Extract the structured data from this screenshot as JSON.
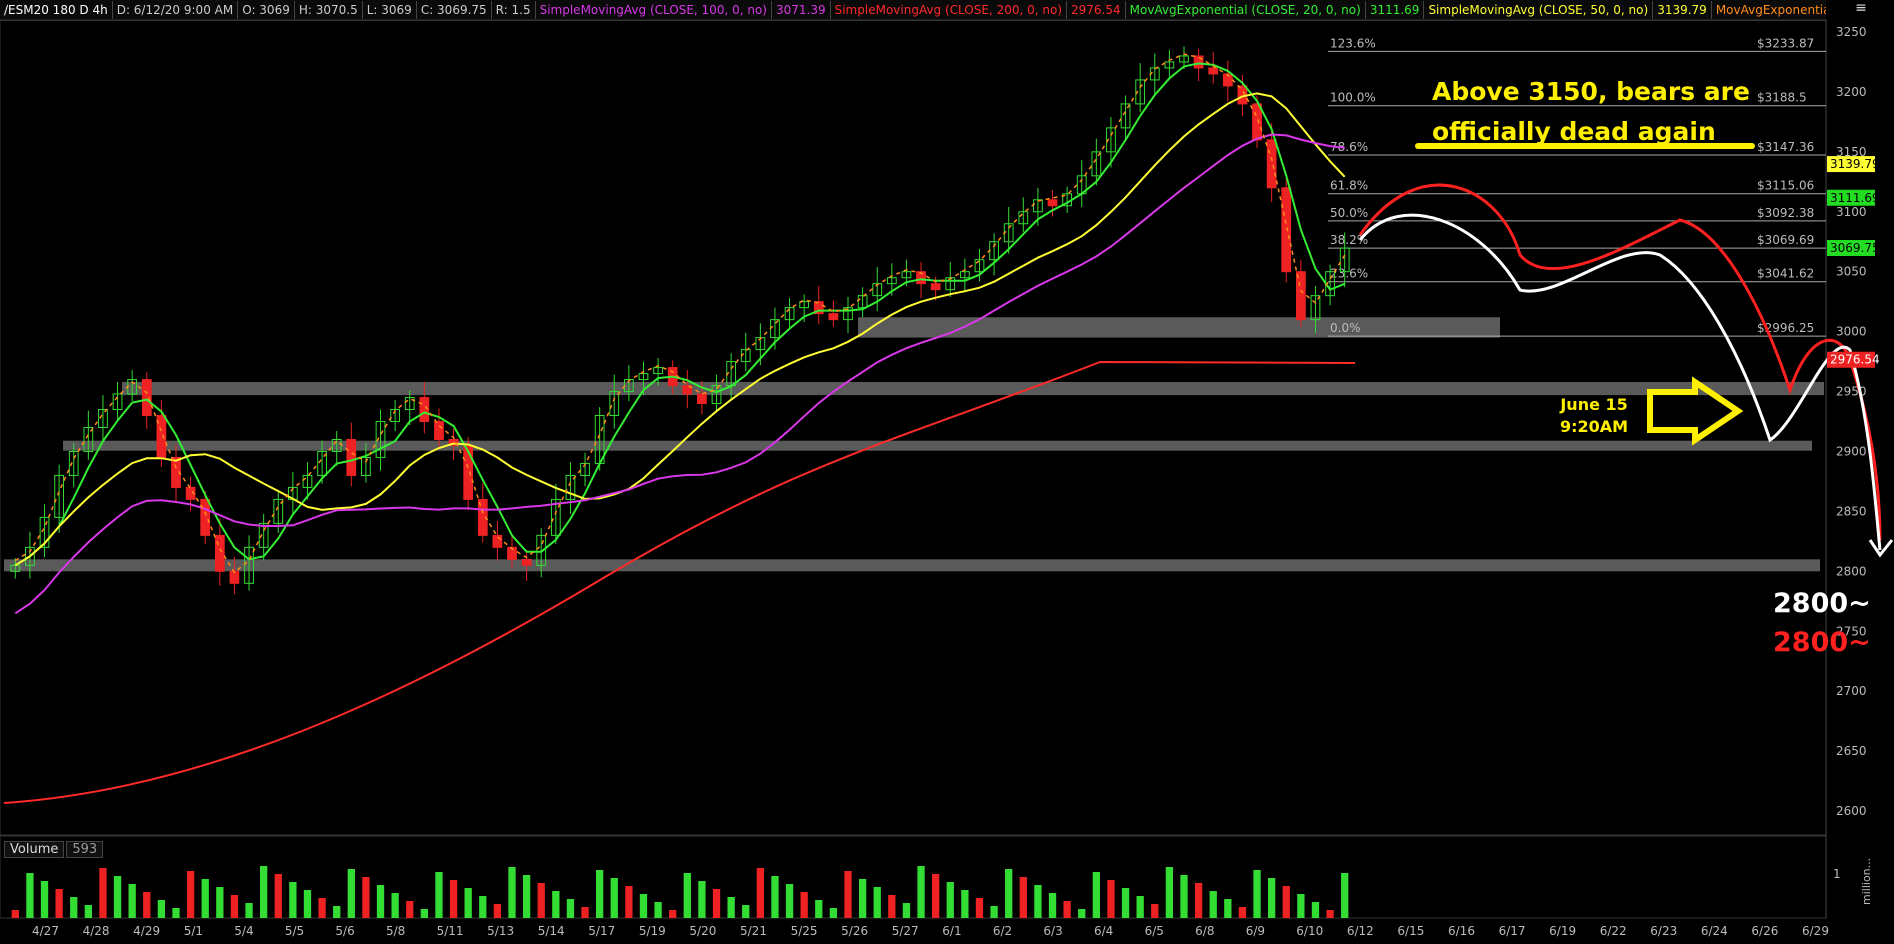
{
  "header": {
    "symbol": "/ESM20 180 D 4h",
    "date": "D: 6/12/20 9:00 AM",
    "open": "O: 3069",
    "high": "H: 3070.5",
    "low": "L: 3069",
    "close": "C: 3069.75",
    "range": "R: 1.5",
    "studies": [
      {
        "label": "SimpleMovingAvg (CLOSE, 100, 0, no)",
        "value": "3071.39",
        "color": "#d838e8"
      },
      {
        "label": "SimpleMovingAvg (CLOSE, 200, 0, no)",
        "value": "2976.54",
        "color": "#ff2a2a"
      },
      {
        "label": "MovAvgExponential (CLOSE, 20, 0, no)",
        "value": "3111.69",
        "color": "#33ee33"
      },
      {
        "label": "SimpleMovingAvg (CLOSE, 50, 0, no)",
        "value": "3139.79",
        "color": "#ffff33"
      },
      {
        "label": "MovAvgExponential (CLOSE...",
        "value": "",
        "color": "#ff8c1a"
      }
    ]
  },
  "volume_panel": {
    "label": "Volume",
    "value": "593",
    "scale_label": "1",
    "unit": "million..."
  },
  "annotations": {
    "main_text_line1": "Above 3150, bears are",
    "main_text_line2": "officially dead again",
    "date_line1": "June 15",
    "date_line2": "9:20AM",
    "target_white": "2800~",
    "target_red": "2800~"
  },
  "colors": {
    "background": "#000000",
    "up_candle": "#33dd33",
    "down_candle": "#ee2222",
    "sma100": "#d838e8",
    "sma200": "#ff2a2a",
    "ema20": "#33ee33",
    "sma50": "#ffff33",
    "ema_orange": "#ff8c1a",
    "zone": "#808080",
    "annotation_yellow": "#ffef00"
  },
  "chart_data": {
    "type": "candlestick",
    "title": "/ESM20 180 D 4h",
    "ylim": [
      2580,
      3260
    ],
    "y_ticks": [
      2600,
      2650,
      2700,
      2750,
      2800,
      2850,
      2900,
      2950,
      3000,
      3050,
      3100,
      3150,
      3200,
      3250
    ],
    "x_ticks": [
      "4/27",
      "4/28",
      "4/29",
      "5/1",
      "5/4",
      "5/5",
      "5/6",
      "5/8",
      "5/11",
      "5/13",
      "5/14",
      "5/17",
      "5/19",
      "5/20",
      "5/21",
      "5/25",
      "5/26",
      "5/27",
      "6/1",
      "6/2",
      "6/3",
      "6/4",
      "6/5",
      "6/8",
      "6/9",
      "6/10",
      "6/12",
      "6/15",
      "6/16",
      "6/17",
      "6/19",
      "6/22",
      "6/23",
      "6/24",
      "6/26",
      "6/29"
    ],
    "fibonacci": [
      {
        "pct": "123.6%",
        "price": "$3233.87",
        "value": 3233.87
      },
      {
        "pct": "100.0%",
        "price": "$3188.5",
        "value": 3188.5
      },
      {
        "pct": "78.6%",
        "price": "$3147.36",
        "value": 3147.36
      },
      {
        "pct": "61.8%",
        "price": "$3115.06",
        "value": 3115.06
      },
      {
        "pct": "50.0%",
        "price": "$3092.38",
        "value": 3092.38
      },
      {
        "pct": "38.2%",
        "price": "$3069.69",
        "value": 3069.69
      },
      {
        "pct": "23.6%",
        "price": "$3041.62",
        "value": 3041.62
      },
      {
        "pct": "0.0%",
        "price": "$2996.25",
        "value": 2996.25
      }
    ],
    "price_tags": [
      {
        "text": "3139.79",
        "value": 3139.79,
        "color": "#ffff33",
        "fg": "#000"
      },
      {
        "text": "3111.69",
        "value": 3111.69,
        "color": "#22dd22",
        "fg": "#000"
      },
      {
        "text": "3069.75",
        "value": 3069.75,
        "color": "#22dd22",
        "fg": "#000"
      },
      {
        "text": "2976.54",
        "value": 2976.54,
        "color": "#ee2222",
        "fg": "#fff"
      }
    ],
    "zones": [
      {
        "low": 2995,
        "high": 3012,
        "start_date": "5/26",
        "end": "6/12+"
      },
      {
        "low": 2947,
        "high": 2958,
        "start_date": "4/28",
        "end": "right edge"
      },
      {
        "low": 2901,
        "high": 2909,
        "start_date": "4/27",
        "end": "6/29"
      },
      {
        "low": 2800,
        "high": 2810,
        "start_date": "4/27",
        "end": "right edge"
      }
    ],
    "closes": [
      2805,
      2820,
      2845,
      2880,
      2900,
      2920,
      2935,
      2948,
      2960,
      2930,
      2895,
      2870,
      2860,
      2830,
      2800,
      2790,
      2820,
      2840,
      2860,
      2870,
      2880,
      2900,
      2910,
      2880,
      2895,
      2925,
      2935,
      2945,
      2925,
      2910,
      2905,
      2860,
      2830,
      2820,
      2810,
      2805,
      2830,
      2860,
      2880,
      2890,
      2930,
      2950,
      2960,
      2965,
      2970,
      2955,
      2948,
      2940,
      2955,
      2975,
      2985,
      2995,
      3010,
      3020,
      3025,
      3015,
      3010,
      3020,
      3030,
      3040,
      3045,
      3050,
      3040,
      3035,
      3045,
      3050,
      3060,
      3075,
      3090,
      3100,
      3110,
      3105,
      3115,
      3130,
      3150,
      3170,
      3190,
      3210,
      3220,
      3225,
      3230,
      3220,
      3215,
      3205,
      3190,
      3160,
      3120,
      3050,
      3010,
      3030,
      3050,
      3069.75
    ]
  }
}
